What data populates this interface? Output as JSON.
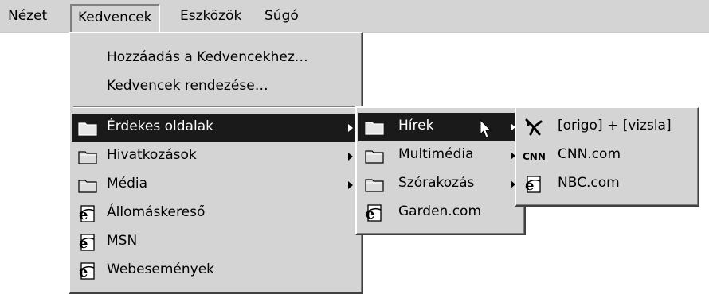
{
  "menubar": {
    "items": [
      {
        "label": "Nézet"
      },
      {
        "label": "Kedvencek"
      },
      {
        "label": "Eszközök"
      },
      {
        "label": "Súgó"
      }
    ]
  },
  "favorites_menu": {
    "add_label": "Hozzáadás a Kedvencekhez…",
    "organize_label": "Kedvencek rendezése…",
    "items": [
      {
        "label": "Érdekes oldalak",
        "icon": "folder-icon"
      },
      {
        "label": "Hivatkozások",
        "icon": "folder-icon"
      },
      {
        "label": "Média",
        "icon": "folder-icon"
      },
      {
        "label": "Állomáskereső",
        "icon": "ie-page-icon"
      },
      {
        "label": "MSN",
        "icon": "ie-page-icon"
      },
      {
        "label": "Webesemények",
        "icon": "ie-page-icon"
      }
    ]
  },
  "interesting_submenu": {
    "items": [
      {
        "label": "Hírek",
        "icon": "folder-icon"
      },
      {
        "label": "Multimédia",
        "icon": "folder-icon"
      },
      {
        "label": "Szórakozás",
        "icon": "folder-icon"
      },
      {
        "label": "Garden.com",
        "icon": "ie-page-icon"
      }
    ]
  },
  "news_submenu": {
    "items": [
      {
        "label": "[origo] + [vizsla]",
        "icon": "origo-icon"
      },
      {
        "label": "CNN.com",
        "icon": "cnn-icon"
      },
      {
        "label": "NBC.com",
        "icon": "ie-page-icon"
      }
    ]
  },
  "colors": {
    "menu_bg": "#d4d4d4",
    "highlight_bg": "#1a1a1a",
    "highlight_text": "#ffffff"
  }
}
